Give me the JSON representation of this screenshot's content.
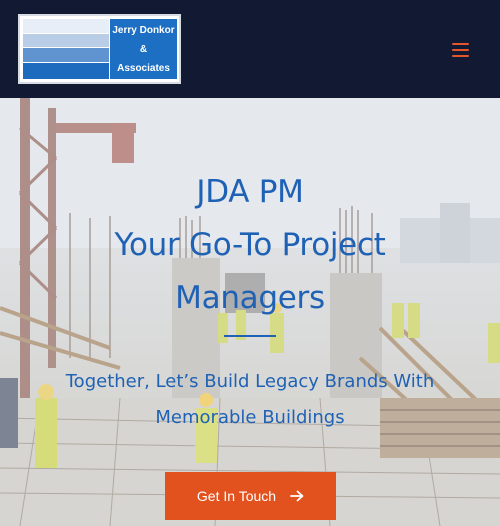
{
  "header": {
    "logo": {
      "line1": "Jerry Donkor",
      "line2": "&",
      "line3": "Associates"
    },
    "menu_icon": "hamburger-menu-icon",
    "accent_color": "#e3552a",
    "background_color": "#121a33"
  },
  "hero": {
    "title_line1": "JDA PM",
    "title_line2": "Your Go-To Project",
    "title_line3": "Managers",
    "subtitle_line1": "Together, Let’s Build Legacy Brands With",
    "subtitle_line2": "Memorable Buildings",
    "cta_label": "Get In Touch",
    "cta_icon": "arrow-right-icon",
    "text_color": "#1f62b5",
    "cta_color": "#e1521f"
  }
}
